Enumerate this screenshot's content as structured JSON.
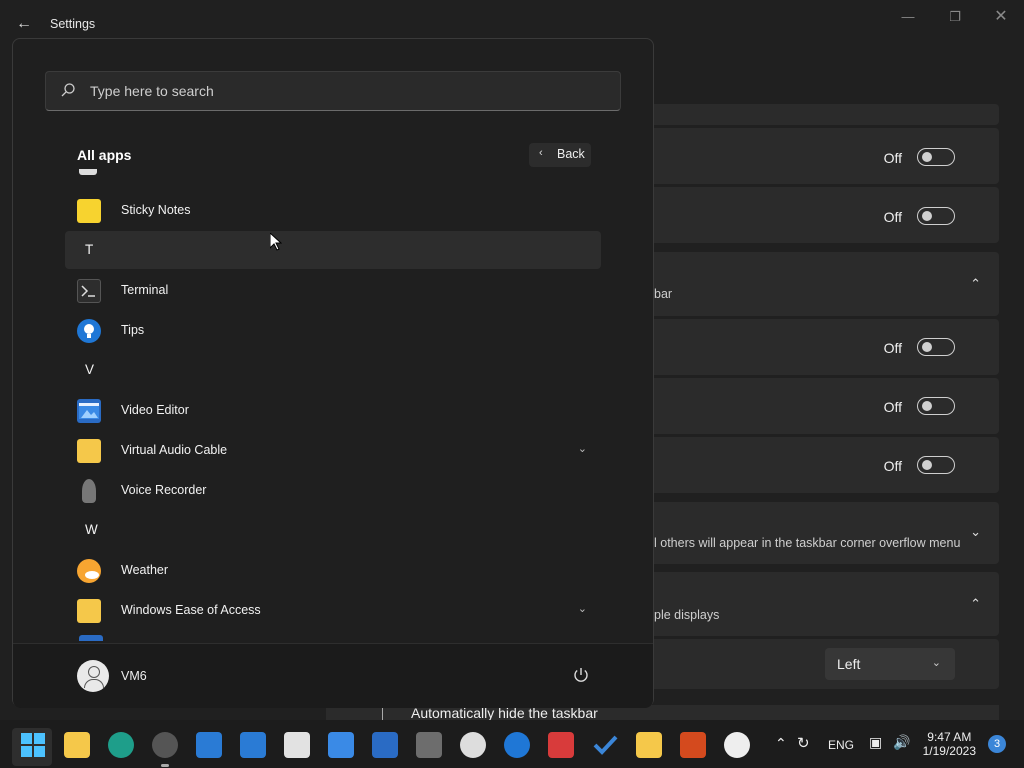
{
  "window": {
    "title": "Settings",
    "controls": [
      "minimize",
      "maximize",
      "close"
    ]
  },
  "settings_bg": {
    "off_label": "Off",
    "partial_text_1": "bar",
    "partial_text_2": "l others will appear in the taskbar corner overflow menu",
    "partial_text_3": "ple displays",
    "dropdown_value": "Left",
    "autohide_label": "Automatically hide the taskbar"
  },
  "start_menu": {
    "search_placeholder": "Type here to search",
    "all_apps_title": "All apps",
    "back_label": "Back",
    "apps": [
      {
        "type": "app",
        "name": "Sticky Notes",
        "icon": "sticky-notes-icon"
      },
      {
        "type": "letter",
        "name": "T"
      },
      {
        "type": "app",
        "name": "Terminal",
        "icon": "terminal-icon"
      },
      {
        "type": "app",
        "name": "Tips",
        "icon": "tips-icon"
      },
      {
        "type": "letter",
        "name": "V"
      },
      {
        "type": "app",
        "name": "Video Editor",
        "icon": "video-editor-icon"
      },
      {
        "type": "folder",
        "name": "Virtual Audio Cable",
        "icon": "folder-icon"
      },
      {
        "type": "app",
        "name": "Voice Recorder",
        "icon": "voice-recorder-icon"
      },
      {
        "type": "letter",
        "name": "W"
      },
      {
        "type": "app",
        "name": "Weather",
        "icon": "weather-icon"
      },
      {
        "type": "folder",
        "name": "Windows Ease of Access",
        "icon": "folder-icon"
      }
    ],
    "user_name": "VM6"
  },
  "taskbar": {
    "language": "ENG",
    "time": "9:47 AM",
    "date": "1/19/2023",
    "notification_count": "3"
  },
  "colors": {
    "accent": "#3b86d8",
    "panel": "#1f1f1f",
    "card": "#2b2b2b"
  }
}
